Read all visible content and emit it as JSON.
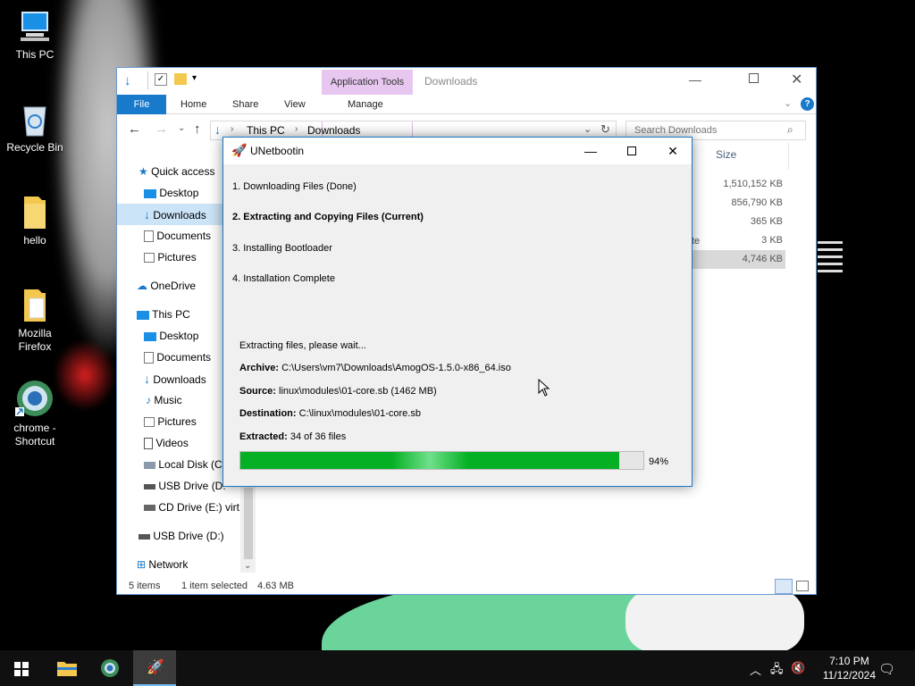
{
  "desktop": {
    "icons": [
      {
        "label": "This PC"
      },
      {
        "label": "Recycle Bin"
      },
      {
        "label": "hello"
      },
      {
        "label": "Mozilla Firefox"
      },
      {
        "label": "chrome - Shortcut"
      }
    ]
  },
  "explorer": {
    "title": "Downloads",
    "ribbon": {
      "file_tab": "File",
      "tabs": [
        "Home",
        "Share",
        "View"
      ],
      "context_group": "Application Tools",
      "context_tab": "Manage"
    },
    "address": {
      "path": [
        "This PC",
        "Downloads"
      ]
    },
    "search_placeholder": "Search Downloads",
    "nav": [
      {
        "label": "Quick access",
        "level": 0
      },
      {
        "label": "Desktop",
        "level": 1
      },
      {
        "label": "Downloads",
        "level": 1,
        "selected": true
      },
      {
        "label": "Documents",
        "level": 1
      },
      {
        "label": "Pictures",
        "level": 1
      },
      {
        "label": "OneDrive",
        "level": 0
      },
      {
        "label": "This PC",
        "level": 0
      },
      {
        "label": "Desktop",
        "level": 1
      },
      {
        "label": "Documents",
        "level": 1
      },
      {
        "label": "Downloads",
        "level": 1
      },
      {
        "label": "Music",
        "level": 1
      },
      {
        "label": "Pictures",
        "level": 1
      },
      {
        "label": "Videos",
        "level": 1
      },
      {
        "label": "Local Disk (C",
        "level": 1
      },
      {
        "label": "USB Drive (D:",
        "level": 1
      },
      {
        "label": "CD Drive (E:) virt",
        "level": 1
      },
      {
        "label": "USB Drive (D:)",
        "level": 0
      },
      {
        "label": "Network",
        "level": 0
      }
    ],
    "column_size": "Size",
    "partial_text": "te",
    "sizes": [
      "1,510,152 KB",
      "856,790 KB",
      "365 KB",
      "3 KB",
      "4,746 KB"
    ],
    "status": {
      "items": "5 items",
      "selected": "1 item selected",
      "size": "4.63 MB"
    }
  },
  "unetbootin": {
    "title": "UNetbootin",
    "steps": [
      {
        "text": "1. Downloading Files (Done)",
        "current": false
      },
      {
        "text": "2. Extracting and Copying Files (Current)",
        "current": true
      },
      {
        "text": "3. Installing Bootloader",
        "current": false
      },
      {
        "text": "4. Installation Complete",
        "current": false
      }
    ],
    "status_line": "Extracting files, please wait...",
    "archive_label": "Archive:",
    "archive_value": "C:\\Users\\vm7\\Downloads\\AmogOS-1.5.0-x86_64.iso",
    "source_label": "Source:",
    "source_value": "linux\\modules\\01-core.sb (1462 MB)",
    "destination_label": "Destination:",
    "destination_value": "C:\\linux\\modules\\01-core.sb",
    "extracted_label": "Extracted:",
    "extracted_value": "34 of 36 files",
    "progress": 94,
    "progress_text": "94%"
  },
  "taskbar": {
    "time": "7:10 PM",
    "date": "11/12/2024"
  },
  "colors": {
    "accent": "#1979ca",
    "progress": "#06b025",
    "app_tools": "#e7c7f0",
    "selected": "#cce4f7"
  }
}
